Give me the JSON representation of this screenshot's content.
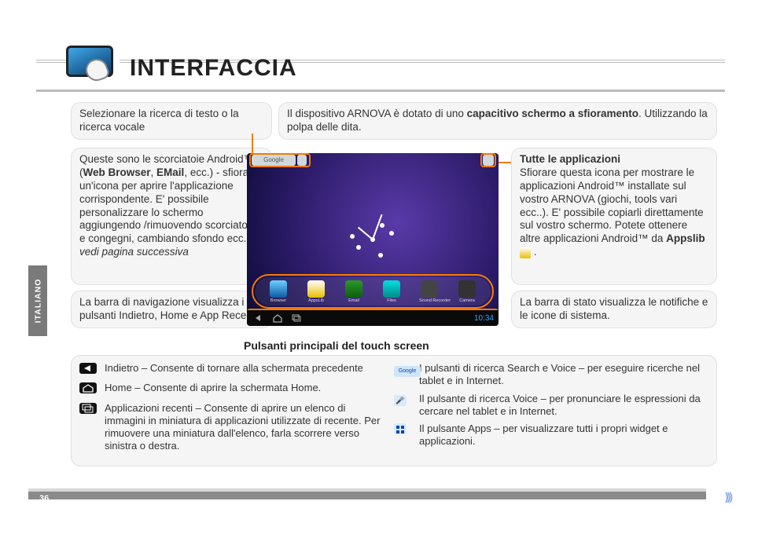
{
  "language": "ITALIANO",
  "page_number": "36",
  "title": "INTERFACCIA",
  "callouts": {
    "search_voice": "Selezionare la ricerca di testo o la ricerca vocale",
    "touchscreen_pre": "Il dispositivo ARNOVA è dotato di uno ",
    "touchscreen_bold": "capacitivo schermo a sfioramento",
    "touchscreen_post": ". Utilizzando la polpa delle dita.",
    "shortcuts_pre": "Queste sono le scorciatoie Android™ (",
    "shortcuts_bold": "Web Browser",
    "shortcuts_mid": ", ",
    "shortcuts_bold2": "EMail",
    "shortcuts_post": ", ecc.) - sfiorare un'icona per aprire l'applicazione corrispondente. E' possibile personalizzare lo schermo aggiungendo /rimuovendo scorciatoie e congegni, cambiando sfondo ecc.. ",
    "shortcuts_ital": "- vedi pagina successiva",
    "navbar": "La barra di navigazione visualizza i pulsanti Indietro, Home e App Recenti.",
    "allapps_title": "Tutte le applicazioni",
    "allapps_body_pre": "Sfiorare questa icona per mostrare le applicazioni Android™ installate sul vostro ARNOVA (giochi, tools vari ecc..). E' possibile copiarli direttamente sul vostro schermo. Potete ottenere altre applicazioni Android™ da ",
    "allapps_body_bold": "Appslib",
    "allapps_body_post": " .",
    "statusbar": "La barra di stato visualizza le notifiche e le icone di sistema."
  },
  "screenshot": {
    "search_label": "Google",
    "dock": [
      {
        "label": "Browser"
      },
      {
        "label": "AppsLib"
      },
      {
        "label": "Email"
      },
      {
        "label": "Files"
      },
      {
        "label": "Sound Recorder"
      },
      {
        "label": "Camera"
      }
    ],
    "time": "10:34"
  },
  "buttons_header": "Pulsanti principali del touch screen",
  "buttons": {
    "left": [
      {
        "icon": "back",
        "text": "Indietro – Consente di tornare alla schermata precedente"
      },
      {
        "icon": "home",
        "text": "Home – Consente di aprire la schermata Home."
      },
      {
        "icon": "recent",
        "text": "Applicazioni recenti – Consente di aprire un elenco di immagini in miniatura di applicazioni utilizzate di recente. Per rimuovere una miniatura dall'elenco, farla scorrere verso sinistra o destra."
      }
    ],
    "right": [
      {
        "icon": "search",
        "text": "I pulsanti di ricerca Search e Voice – per eseguire ricerche nel tablet e in Internet."
      },
      {
        "icon": "voice",
        "text": "Il pulsante di ricerca Voice – per pronunciare le espressioni da cercare nel tablet e in Internet."
      },
      {
        "icon": "apps",
        "text": "Il pulsante Apps – per visualizzare tutti i propri widget e applicazioni."
      }
    ]
  }
}
